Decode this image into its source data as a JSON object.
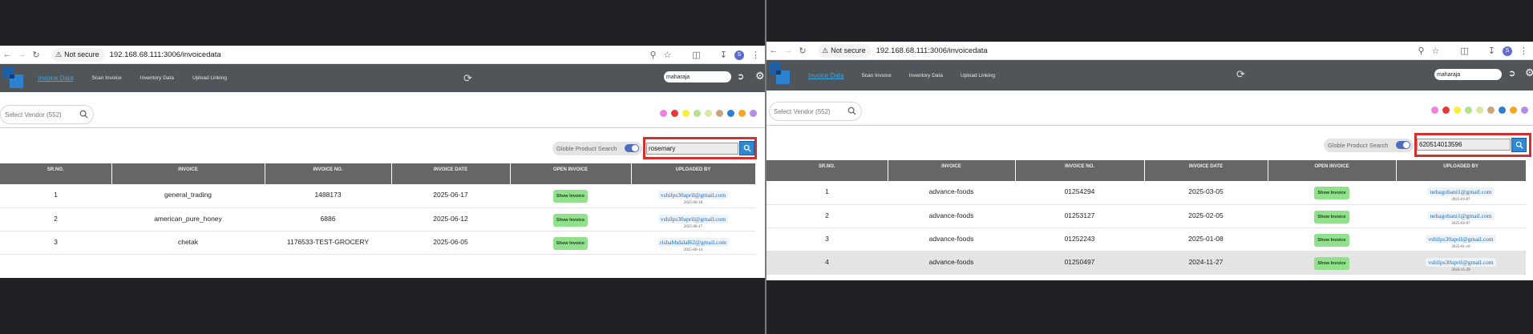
{
  "browser": {
    "not_secure": "Not secure",
    "url": "192.168.68.111:3006/invoicedata",
    "profile_initial": "S"
  },
  "nav": {
    "active": "Invoice Data",
    "links": [
      "Scan Invoice",
      "Inventory Data",
      "Upload Linking"
    ],
    "user": "maharaja"
  },
  "vendor": {
    "placeholder": "Select Vendor (552)"
  },
  "dot_colors": [
    "#ef7fe2",
    "#e53935",
    "#f8ef3a",
    "#b7e08c",
    "#dbe6a1",
    "#c9a47f",
    "#2d7dd2",
    "#f6a623",
    "#b68ce8"
  ],
  "globle_label": "Globle Product Search",
  "table": {
    "headers": [
      "SR.NO.",
      "INVOICE",
      "INVOICE NO.",
      "INVOICE DATE",
      "OPEN INVOICE",
      "UPLOADED BY"
    ],
    "show_label": "Show Invoice"
  },
  "left": {
    "search_value": "rosemary",
    "rows": [
      {
        "sr": "1",
        "invoice": "general_trading",
        "no": "1488173",
        "date": "2025-06-17",
        "email": "vshilps30april@gmail.com",
        "uploaded": "2025-06-18"
      },
      {
        "sr": "2",
        "invoice": "american_pure_honey",
        "no": "6886",
        "date": "2025-06-12",
        "email": "vshilps30april@gmail.com",
        "uploaded": "2025-06-17"
      },
      {
        "sr": "3",
        "invoice": "chetak",
        "no": "1176533-TEST-GROCERY",
        "date": "2025-06-05",
        "email": "rishabhdalal62@gmail.com",
        "uploaded": "2025-06-14"
      }
    ]
  },
  "right": {
    "search_value": "620514013596",
    "rows": [
      {
        "sr": "1",
        "invoice": "advance-foods",
        "no": "01254294",
        "date": "2025-03-05",
        "email": "nehagobani1@gmail.com",
        "uploaded": "2025-03-07"
      },
      {
        "sr": "2",
        "invoice": "advance-foods",
        "no": "01253127",
        "date": "2025-02-05",
        "email": "nehagobani1@gmail.com",
        "uploaded": "2025-02-07"
      },
      {
        "sr": "3",
        "invoice": "advance-foods",
        "no": "01252243",
        "date": "2025-01-08",
        "email": "vshilps30april@gmail.com",
        "uploaded": "2025-01-10"
      },
      {
        "sr": "4",
        "invoice": "advance-foods",
        "no": "01250497",
        "date": "2024-11-27",
        "email": "vshilps30april@gmail.com",
        "uploaded": "2024-11-29"
      }
    ]
  }
}
